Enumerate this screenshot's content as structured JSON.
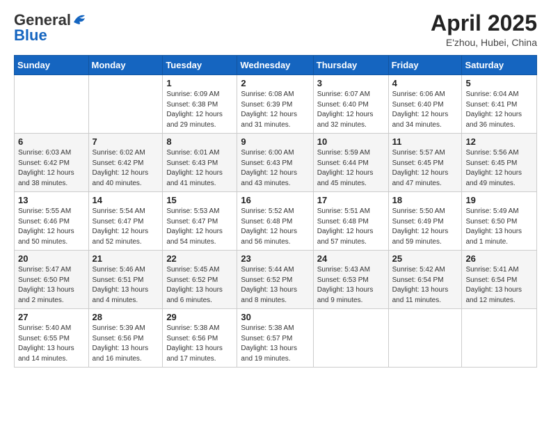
{
  "header": {
    "logo_line1": "General",
    "logo_line2": "Blue",
    "title": "April 2025",
    "location": "E'zhou, Hubei, China"
  },
  "days_of_week": [
    "Sunday",
    "Monday",
    "Tuesday",
    "Wednesday",
    "Thursday",
    "Friday",
    "Saturday"
  ],
  "weeks": [
    [
      {
        "day": "",
        "sunrise": "",
        "sunset": "",
        "daylight": ""
      },
      {
        "day": "",
        "sunrise": "",
        "sunset": "",
        "daylight": ""
      },
      {
        "day": "1",
        "sunrise": "Sunrise: 6:09 AM",
        "sunset": "Sunset: 6:38 PM",
        "daylight": "Daylight: 12 hours and 29 minutes."
      },
      {
        "day": "2",
        "sunrise": "Sunrise: 6:08 AM",
        "sunset": "Sunset: 6:39 PM",
        "daylight": "Daylight: 12 hours and 31 minutes."
      },
      {
        "day": "3",
        "sunrise": "Sunrise: 6:07 AM",
        "sunset": "Sunset: 6:40 PM",
        "daylight": "Daylight: 12 hours and 32 minutes."
      },
      {
        "day": "4",
        "sunrise": "Sunrise: 6:06 AM",
        "sunset": "Sunset: 6:40 PM",
        "daylight": "Daylight: 12 hours and 34 minutes."
      },
      {
        "day": "5",
        "sunrise": "Sunrise: 6:04 AM",
        "sunset": "Sunset: 6:41 PM",
        "daylight": "Daylight: 12 hours and 36 minutes."
      }
    ],
    [
      {
        "day": "6",
        "sunrise": "Sunrise: 6:03 AM",
        "sunset": "Sunset: 6:42 PM",
        "daylight": "Daylight: 12 hours and 38 minutes."
      },
      {
        "day": "7",
        "sunrise": "Sunrise: 6:02 AM",
        "sunset": "Sunset: 6:42 PM",
        "daylight": "Daylight: 12 hours and 40 minutes."
      },
      {
        "day": "8",
        "sunrise": "Sunrise: 6:01 AM",
        "sunset": "Sunset: 6:43 PM",
        "daylight": "Daylight: 12 hours and 41 minutes."
      },
      {
        "day": "9",
        "sunrise": "Sunrise: 6:00 AM",
        "sunset": "Sunset: 6:43 PM",
        "daylight": "Daylight: 12 hours and 43 minutes."
      },
      {
        "day": "10",
        "sunrise": "Sunrise: 5:59 AM",
        "sunset": "Sunset: 6:44 PM",
        "daylight": "Daylight: 12 hours and 45 minutes."
      },
      {
        "day": "11",
        "sunrise": "Sunrise: 5:57 AM",
        "sunset": "Sunset: 6:45 PM",
        "daylight": "Daylight: 12 hours and 47 minutes."
      },
      {
        "day": "12",
        "sunrise": "Sunrise: 5:56 AM",
        "sunset": "Sunset: 6:45 PM",
        "daylight": "Daylight: 12 hours and 49 minutes."
      }
    ],
    [
      {
        "day": "13",
        "sunrise": "Sunrise: 5:55 AM",
        "sunset": "Sunset: 6:46 PM",
        "daylight": "Daylight: 12 hours and 50 minutes."
      },
      {
        "day": "14",
        "sunrise": "Sunrise: 5:54 AM",
        "sunset": "Sunset: 6:47 PM",
        "daylight": "Daylight: 12 hours and 52 minutes."
      },
      {
        "day": "15",
        "sunrise": "Sunrise: 5:53 AM",
        "sunset": "Sunset: 6:47 PM",
        "daylight": "Daylight: 12 hours and 54 minutes."
      },
      {
        "day": "16",
        "sunrise": "Sunrise: 5:52 AM",
        "sunset": "Sunset: 6:48 PM",
        "daylight": "Daylight: 12 hours and 56 minutes."
      },
      {
        "day": "17",
        "sunrise": "Sunrise: 5:51 AM",
        "sunset": "Sunset: 6:48 PM",
        "daylight": "Daylight: 12 hours and 57 minutes."
      },
      {
        "day": "18",
        "sunrise": "Sunrise: 5:50 AM",
        "sunset": "Sunset: 6:49 PM",
        "daylight": "Daylight: 12 hours and 59 minutes."
      },
      {
        "day": "19",
        "sunrise": "Sunrise: 5:49 AM",
        "sunset": "Sunset: 6:50 PM",
        "daylight": "Daylight: 13 hours and 1 minute."
      }
    ],
    [
      {
        "day": "20",
        "sunrise": "Sunrise: 5:47 AM",
        "sunset": "Sunset: 6:50 PM",
        "daylight": "Daylight: 13 hours and 2 minutes."
      },
      {
        "day": "21",
        "sunrise": "Sunrise: 5:46 AM",
        "sunset": "Sunset: 6:51 PM",
        "daylight": "Daylight: 13 hours and 4 minutes."
      },
      {
        "day": "22",
        "sunrise": "Sunrise: 5:45 AM",
        "sunset": "Sunset: 6:52 PM",
        "daylight": "Daylight: 13 hours and 6 minutes."
      },
      {
        "day": "23",
        "sunrise": "Sunrise: 5:44 AM",
        "sunset": "Sunset: 6:52 PM",
        "daylight": "Daylight: 13 hours and 8 minutes."
      },
      {
        "day": "24",
        "sunrise": "Sunrise: 5:43 AM",
        "sunset": "Sunset: 6:53 PM",
        "daylight": "Daylight: 13 hours and 9 minutes."
      },
      {
        "day": "25",
        "sunrise": "Sunrise: 5:42 AM",
        "sunset": "Sunset: 6:54 PM",
        "daylight": "Daylight: 13 hours and 11 minutes."
      },
      {
        "day": "26",
        "sunrise": "Sunrise: 5:41 AM",
        "sunset": "Sunset: 6:54 PM",
        "daylight": "Daylight: 13 hours and 12 minutes."
      }
    ],
    [
      {
        "day": "27",
        "sunrise": "Sunrise: 5:40 AM",
        "sunset": "Sunset: 6:55 PM",
        "daylight": "Daylight: 13 hours and 14 minutes."
      },
      {
        "day": "28",
        "sunrise": "Sunrise: 5:39 AM",
        "sunset": "Sunset: 6:56 PM",
        "daylight": "Daylight: 13 hours and 16 minutes."
      },
      {
        "day": "29",
        "sunrise": "Sunrise: 5:38 AM",
        "sunset": "Sunset: 6:56 PM",
        "daylight": "Daylight: 13 hours and 17 minutes."
      },
      {
        "day": "30",
        "sunrise": "Sunrise: 5:38 AM",
        "sunset": "Sunset: 6:57 PM",
        "daylight": "Daylight: 13 hours and 19 minutes."
      },
      {
        "day": "",
        "sunrise": "",
        "sunset": "",
        "daylight": ""
      },
      {
        "day": "",
        "sunrise": "",
        "sunset": "",
        "daylight": ""
      },
      {
        "day": "",
        "sunrise": "",
        "sunset": "",
        "daylight": ""
      }
    ]
  ]
}
